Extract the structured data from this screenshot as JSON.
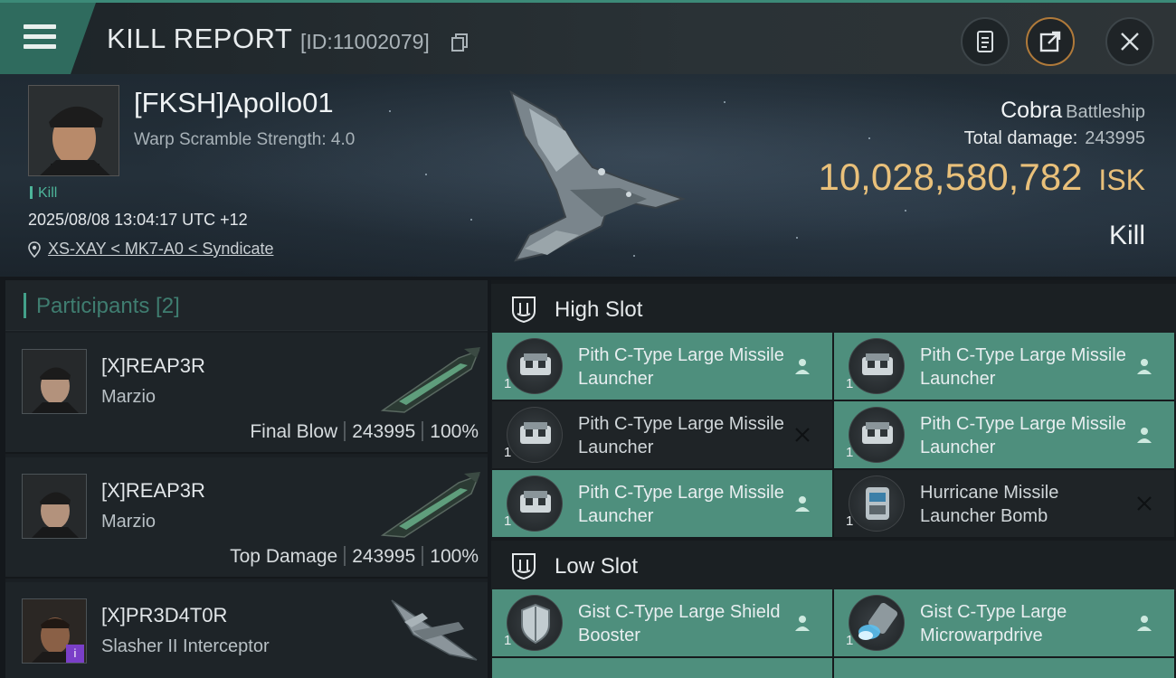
{
  "header": {
    "title": "KILL REPORT",
    "report_id": "[ID:11002079]"
  },
  "victim": {
    "name": "[FKSH]Apollo01",
    "warp_scramble": "Warp Scramble Strength: 4.0",
    "tag": "Kill",
    "datetime": "2025/08/08 13:04:17 UTC +12",
    "location": "XS-XAY < MK7-A0 < Syndicate",
    "ship_name": "Cobra",
    "ship_class": "Battleship",
    "total_damage_label": "Total damage:",
    "total_damage": "243995",
    "isk_value": "10,028,580,782",
    "isk_unit": "ISK",
    "result": "Kill"
  },
  "participants": {
    "label": "Participants [2]",
    "rows": [
      {
        "corp_name": "[X]REAP3R",
        "ship": "Marzio",
        "role": "Final Blow",
        "damage": "243995",
        "percent": "100%"
      },
      {
        "corp_name": "[X]REAP3R",
        "ship": "Marzio",
        "role": "Top Damage",
        "damage": "243995",
        "percent": "100%"
      },
      {
        "corp_name": "[X]PR3D4T0R",
        "ship": "Slasher II Interceptor",
        "badge": "i"
      }
    ]
  },
  "slots": {
    "high_label": "High Slot",
    "low_label": "Low Slot",
    "high": [
      {
        "name": "Pith C-Type Large Missile Launcher",
        "qty": "1",
        "state": "dropped"
      },
      {
        "name": "Pith C-Type Large Missile Launcher",
        "qty": "1",
        "state": "dropped"
      },
      {
        "name": "Pith C-Type Large Missile Launcher",
        "qty": "1",
        "state": "destroyed"
      },
      {
        "name": "Pith C-Type Large Missile Launcher",
        "qty": "1",
        "state": "dropped"
      },
      {
        "name": "Pith C-Type Large Missile Launcher",
        "qty": "1",
        "state": "dropped"
      },
      {
        "name": "Hurricane Missile Launcher Bomb",
        "qty": "1",
        "state": "destroyed"
      }
    ],
    "low": [
      {
        "name": "Gist C-Type Large Shield Booster",
        "qty": "1",
        "state": "dropped"
      },
      {
        "name": "Gist C-Type Large Microwarpdrive",
        "qty": "1",
        "state": "dropped"
      }
    ]
  },
  "colors": {
    "accent_green": "#4e8f7d",
    "isk_gold": "#e9c07a",
    "participant_label": "#3f7d70"
  },
  "icons": {
    "menu": "hamburger-icon",
    "copy": "copy-icon",
    "clipboard": "clipboard-icon",
    "share": "share-icon",
    "close": "close-icon",
    "location": "pin-icon",
    "slot": "shield-slot-icon",
    "dropped": "person-icon",
    "destroyed": "x-icon"
  }
}
